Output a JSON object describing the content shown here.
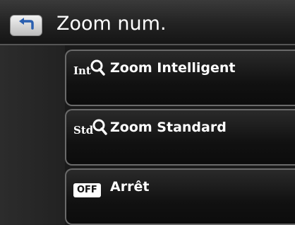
{
  "header": {
    "title": "Zoom num.",
    "back_icon": "back-arrow-icon"
  },
  "menu": {
    "items": [
      {
        "icon_text": "Int",
        "icon": "magnifier-icon",
        "label": "Zoom Intelligent"
      },
      {
        "icon_text": "Std",
        "icon": "magnifier-icon",
        "label": "Zoom Standard"
      },
      {
        "icon_text": "OFF",
        "icon": "off-badge-icon",
        "label": "Arrêt"
      }
    ]
  },
  "colors": {
    "background": "#1a1a1a",
    "item_border": "#6a6a6a",
    "text": "#ffffff"
  }
}
